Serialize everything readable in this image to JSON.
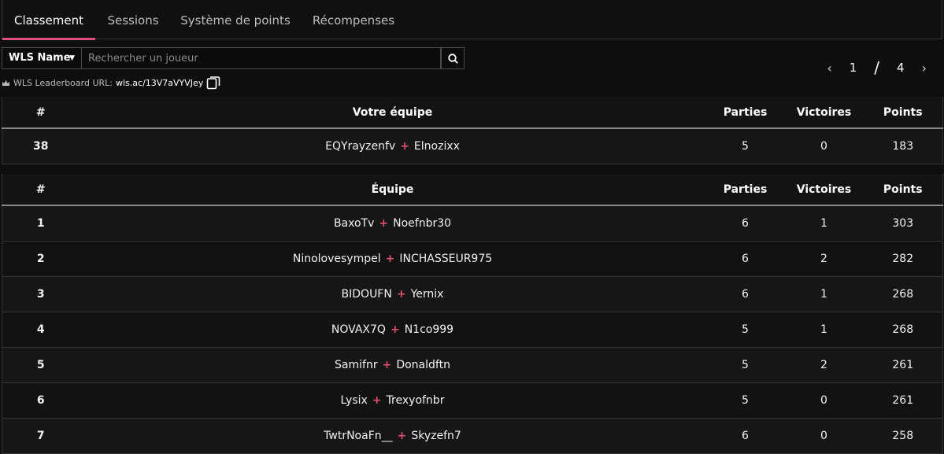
{
  "tabs": [
    {
      "label": "Classement",
      "active": true
    },
    {
      "label": "Sessions",
      "active": false
    },
    {
      "label": "Système de points",
      "active": false
    },
    {
      "label": "Récompenses",
      "active": false
    }
  ],
  "search": {
    "dropdown_value": "WLS Name",
    "placeholder": "Rechercher un joueur",
    "value": ""
  },
  "url": {
    "label": "WLS Leaderboard URL:",
    "link": "wls.ac/13V7aVYVJey"
  },
  "pagination": {
    "current": "1",
    "separator": "/",
    "total": "4"
  },
  "your_team": {
    "headers": {
      "rank": "#",
      "team": "Votre équipe",
      "games": "Parties",
      "wins": "Victoires",
      "points": "Points"
    },
    "row": {
      "rank": "38",
      "player1": "EQYrayzenfv",
      "player2": "Elnozixx",
      "games": "5",
      "wins": "0",
      "points": "183"
    }
  },
  "leaderboard": {
    "headers": {
      "rank": "#",
      "team": "Équipe",
      "games": "Parties",
      "wins": "Victoires",
      "points": "Points"
    },
    "rows": [
      {
        "rank": "1",
        "player1": "BaxoTv",
        "player2": "Noefnbr30",
        "games": "6",
        "wins": "1",
        "points": "303"
      },
      {
        "rank": "2",
        "player1": "Ninolovesympel",
        "player2": "INCHASSEUR975",
        "games": "6",
        "wins": "2",
        "points": "282"
      },
      {
        "rank": "3",
        "player1": "BIDOUFN",
        "player2": "Yernix",
        "games": "6",
        "wins": "1",
        "points": "268"
      },
      {
        "rank": "4",
        "player1": "NOVAX7Q",
        "player2": "N1co999",
        "games": "5",
        "wins": "1",
        "points": "268"
      },
      {
        "rank": "5",
        "player1": "Samifnr",
        "player2": "Donaldftn",
        "games": "5",
        "wins": "2",
        "points": "261"
      },
      {
        "rank": "6",
        "player1": "Lysix",
        "player2": "Trexyofnbr",
        "games": "5",
        "wins": "0",
        "points": "261"
      },
      {
        "rank": "7",
        "player1": "TwtrNoaFn__",
        "player2": "Skyzefn7",
        "games": "6",
        "wins": "0",
        "points": "258"
      }
    ]
  },
  "colors": {
    "accent": "#d94f7e",
    "plus": "#e0506e",
    "background": "#0e0e0e"
  },
  "icons": {
    "search": "search-icon",
    "copy": "copy-icon",
    "crown": "crown-icon",
    "prev": "chevron-left-icon",
    "next": "chevron-right-icon",
    "caret": "caret-down-icon"
  }
}
